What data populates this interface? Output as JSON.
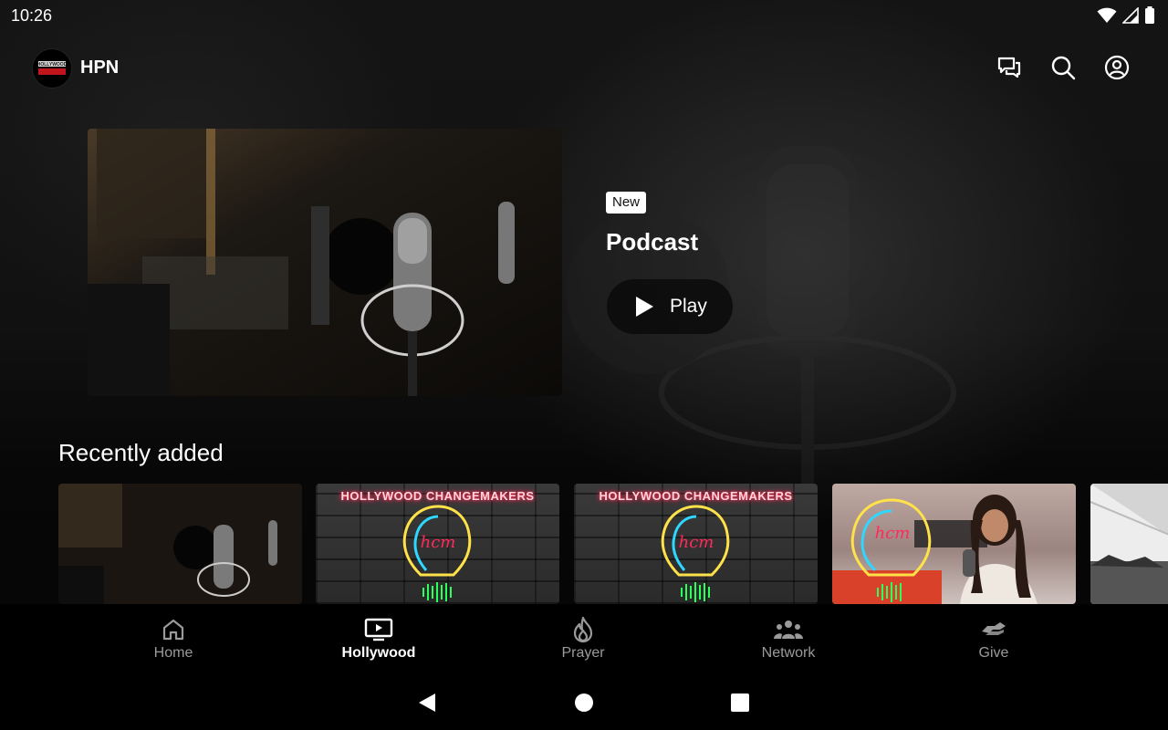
{
  "status_bar": {
    "time": "10:26",
    "icons": [
      "wifi-icon",
      "signal-icon",
      "battery-icon"
    ]
  },
  "app_bar": {
    "app_name": "HPN",
    "logo_text": "HOLLYWOOD",
    "actions": [
      "chat-icon",
      "search-icon",
      "account-icon"
    ]
  },
  "hero": {
    "badge": "New",
    "title": "Podcast",
    "play_label": "Play"
  },
  "recently_added": {
    "title": "Recently added",
    "cards": [
      {
        "kind": "podcast-microphone"
      },
      {
        "kind": "hcm-neon",
        "heading": "HOLLYWOOD CHANGEMAKERS",
        "bulb_text": "hcm"
      },
      {
        "kind": "hcm-neon",
        "heading": "HOLLYWOOD CHANGEMAKERS",
        "bulb_text": "hcm"
      },
      {
        "kind": "hcm-guest",
        "bulb_text": "hcm"
      },
      {
        "kind": "landscape"
      }
    ]
  },
  "bottom_nav": {
    "active": "Hollywood",
    "items": [
      {
        "label": "Home",
        "icon": "home-icon"
      },
      {
        "label": "Hollywood",
        "icon": "tv-icon"
      },
      {
        "label": "Prayer",
        "icon": "flame-icon"
      },
      {
        "label": "Network",
        "icon": "people-icon"
      },
      {
        "label": "Give",
        "icon": "handshake-icon"
      }
    ]
  },
  "system_nav": [
    "back-icon",
    "home-circle-icon",
    "recents-icon"
  ],
  "colors": {
    "background": "#0a0a0a",
    "neon_pink": "#ff2a5a",
    "neon_yellow": "#ffe14a",
    "neon_cyan": "#2fd6ff",
    "neon_green": "#2bff5a",
    "inactive_label": "#9a9a9a"
  }
}
